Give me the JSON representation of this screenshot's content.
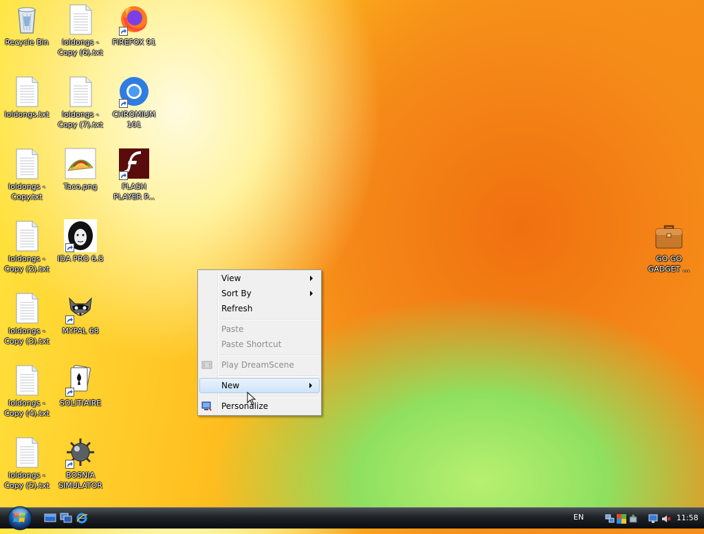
{
  "desktop": {
    "icons": [
      {
        "label": "Recycle Bin",
        "icon": "recycle-bin-icon"
      },
      {
        "label": "loldongs - Copy (6).txt",
        "icon": "text-file-icon"
      },
      {
        "label": "FIREFOX 91",
        "icon": "firefox-icon"
      },
      {
        "label": "loldongs.txt",
        "icon": "text-file-icon"
      },
      {
        "label": "loldongs - Copy (7).txt",
        "icon": "text-file-icon"
      },
      {
        "label": "CHROMIUM 101",
        "icon": "chromium-icon"
      },
      {
        "label": "loldongs - Copy.txt",
        "icon": "text-file-icon"
      },
      {
        "label": "Taco.png",
        "icon": "taco-image-icon"
      },
      {
        "label": "FLASH PLAYER P...",
        "icon": "flash-player-icon"
      },
      {
        "label": "loldongs - Copy (2).txt",
        "icon": "text-file-icon"
      },
      {
        "label": "IDA PRO 6.8",
        "icon": "ida-pro-icon"
      },
      {
        "label": "loldongs - Copy (3).txt",
        "icon": "text-file-icon"
      },
      {
        "label": "MYPAL 68",
        "icon": "mypal-raccoon-icon"
      },
      {
        "label": "loldongs - Copy (4).txt",
        "icon": "text-file-icon"
      },
      {
        "label": "SOLITIAIRE",
        "icon": "solitaire-icon"
      },
      {
        "label": "loldongs - Copy (5).txt",
        "icon": "text-file-icon"
      },
      {
        "label": "BOSNIA SIMULATOR",
        "icon": "minesweeper-icon"
      },
      {
        "label": "GO GO GADGET ...",
        "icon": "briefcase-icon"
      }
    ]
  },
  "context_menu": {
    "items": [
      {
        "label": "View",
        "submenu": true,
        "enabled": true
      },
      {
        "label": "Sort By",
        "submenu": true,
        "enabled": true
      },
      {
        "label": "Refresh",
        "enabled": true
      },
      {
        "label": "Paste",
        "enabled": false
      },
      {
        "label": "Paste Shortcut",
        "enabled": false
      },
      {
        "label": "Play DreamScene",
        "enabled": false,
        "icon": "dreamscene-icon"
      },
      {
        "label": "New",
        "submenu": true,
        "enabled": true,
        "highlighted": true
      },
      {
        "label": "Personalize",
        "enabled": true,
        "icon": "personalize-icon"
      }
    ]
  },
  "taskbar": {
    "start_icon": "windows-orb-icon",
    "quick_launch": [
      "show-desktop-icon",
      "switch-windows-icon",
      "internet-explorer-icon"
    ],
    "language": "EN",
    "tray_icons": [
      "network-icon",
      "security-center-icon",
      "safely-remove-icon",
      "display-icon",
      "volume-muted-icon"
    ],
    "clock": "11:58"
  }
}
